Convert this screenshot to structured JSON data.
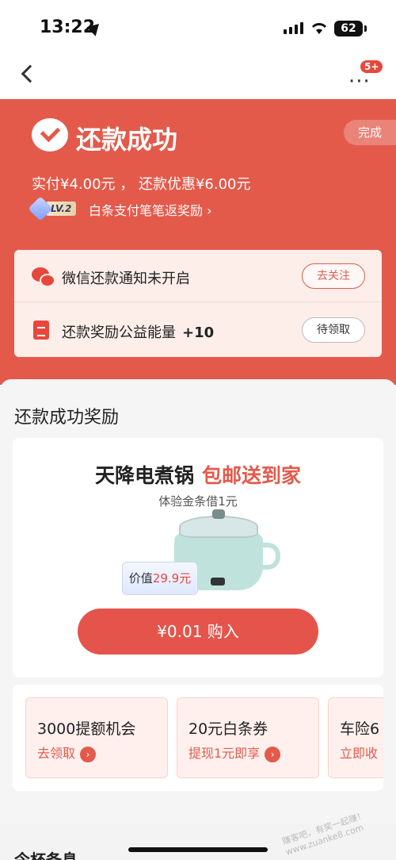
{
  "status_bar": {
    "time": "13:22",
    "battery": "62"
  },
  "nav": {
    "badge": "5+"
  },
  "header": {
    "title": "还款成功",
    "done_label": "完成",
    "pay_summary": "实付¥4.00元 ，  还款优惠¥6.00元",
    "level_badge": "LV.2",
    "level_desc": "白条支付笔笔返奖励 ›"
  },
  "notices": [
    {
      "text": "微信还款通知未开启",
      "action": "去关注"
    },
    {
      "text": "还款奖励公益能量",
      "bonus": "+10",
      "action": "待领取"
    }
  ],
  "rewards": {
    "section_title": "还款成功奖励",
    "promo": {
      "headline_black": "天降电煮锅",
      "headline_red": "包邮送到家",
      "subtitle": "体验金条借1元",
      "value_prefix": "价值",
      "value_amount": "29.9元",
      "buy_label": "¥0.01 购入"
    },
    "coupons": [
      {
        "title": "3000提额机会",
        "subtitle": "去领取"
      },
      {
        "title": "20元白条券",
        "subtitle": "提现1元即享"
      },
      {
        "title": "车险6",
        "subtitle": "立即收"
      }
    ]
  },
  "footer": {
    "partial_heading": "今杯备息"
  },
  "watermark": "赚客吧，有奖一起赚！www.zuanke8.com",
  "colors": {
    "brand_red": "#e35a4b",
    "header_bg": "#e35a4b"
  }
}
